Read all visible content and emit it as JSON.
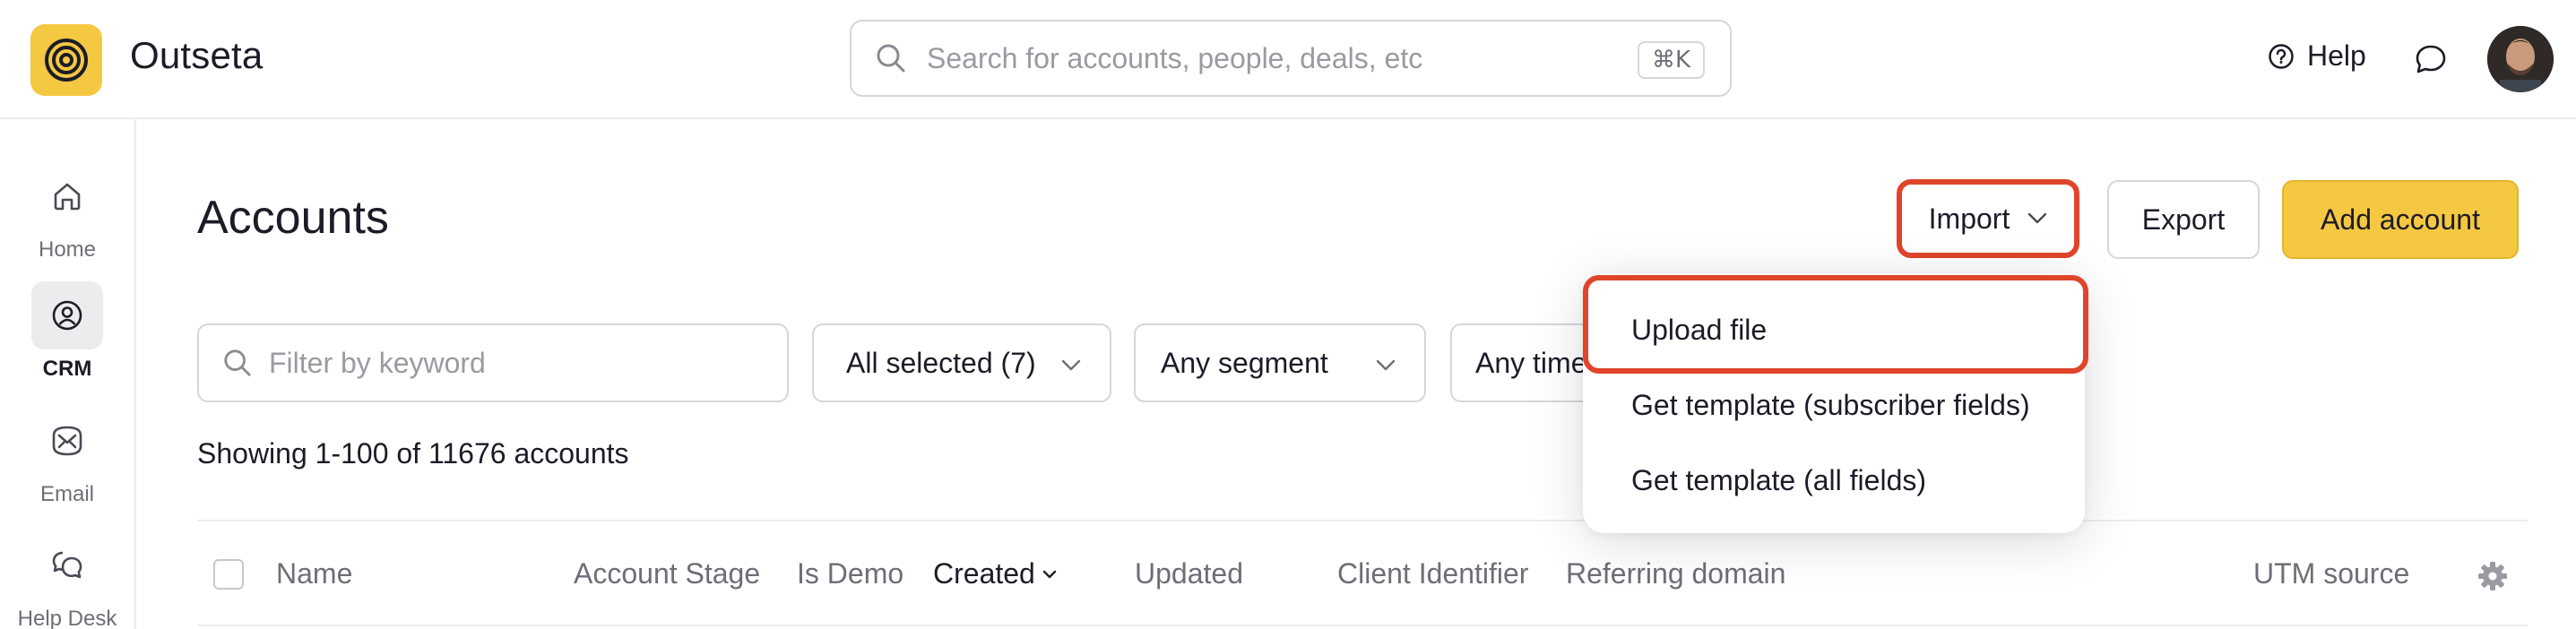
{
  "app": {
    "brand": "Outseta",
    "search": {
      "placeholder": "Search for accounts, people, deals, etc",
      "shortcut": "⌘K"
    },
    "help_label": "Help",
    "colors": {
      "accent": "#f5c842",
      "highlight": "#e0452b"
    }
  },
  "sidebar": {
    "items": [
      {
        "label": "Home",
        "icon": "home-icon",
        "active": false
      },
      {
        "label": "CRM",
        "icon": "crm-icon",
        "active": true
      },
      {
        "label": "Email",
        "icon": "email-icon",
        "active": false
      },
      {
        "label": "Help Desk",
        "icon": "help-desk-icon",
        "active": false
      }
    ]
  },
  "page": {
    "title": "Accounts",
    "buttons": {
      "import": "Import",
      "export": "Export",
      "add": "Add account"
    },
    "filters": {
      "keyword_placeholder": "Filter by keyword",
      "stage": "All selected (7)",
      "segment": "Any segment",
      "time": "Any time"
    },
    "showing": "Showing 1-100 of 11676 accounts",
    "columns": [
      "Name",
      "Account Stage",
      "Is Demo",
      "Created",
      "Updated",
      "Client Identifier",
      "Referring domain",
      "UTM source"
    ],
    "sorted_column": "Created"
  },
  "import_menu": {
    "items": [
      "Upload file",
      "Get template (subscriber fields)",
      "Get template (all fields)"
    ]
  }
}
